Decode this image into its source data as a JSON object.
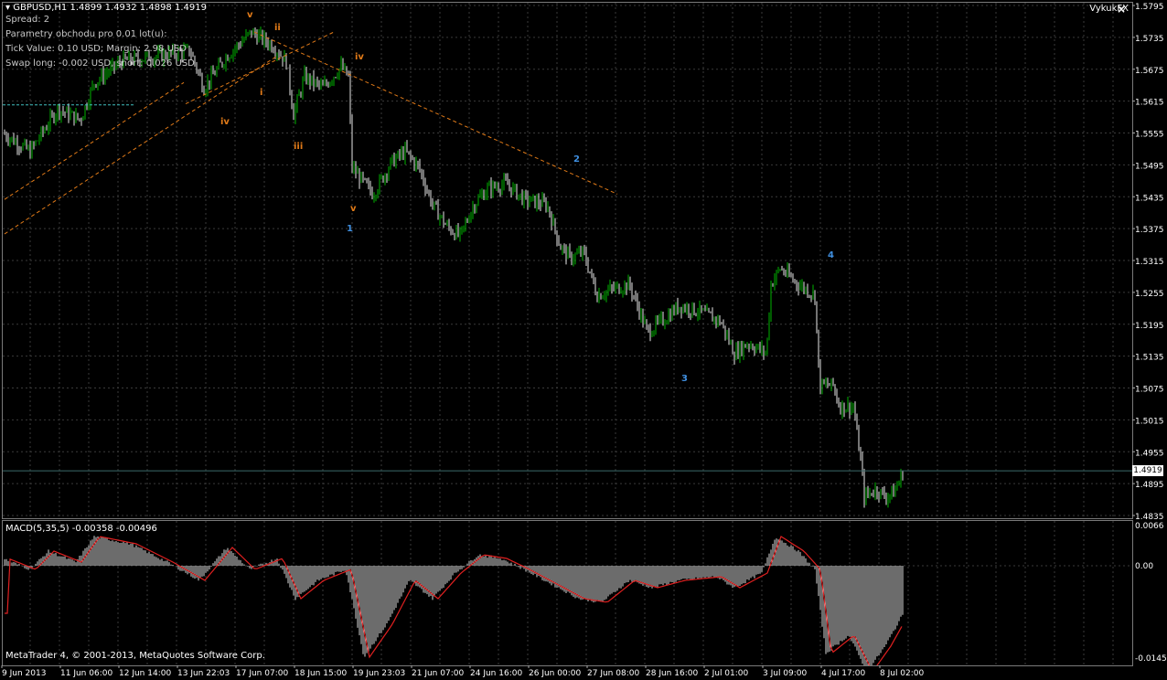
{
  "window": {
    "title": "GBPUSD,H1  1.4899 1.4932 1.4898 1.4919",
    "broker_badge": "VykukFX",
    "close_glyph": "×"
  },
  "info_lines": [
    "Spread: 2",
    "Parametry obchodu pro 0.01 lot(u):",
    "Tick Value: 0.10 USD; Margin: 2.98 USD",
    "Swap long: -0.002 USD, short: 0.026 USD"
  ],
  "price_axis": [
    "1.5795",
    "1.5735",
    "1.5675",
    "1.5615",
    "1.5555",
    "1.5495",
    "1.5435",
    "1.5375",
    "1.5315",
    "1.5255",
    "1.5195",
    "1.5135",
    "1.5075",
    "1.5015",
    "1.4955",
    "1.4895",
    "1.4835"
  ],
  "current_price": "1.4919",
  "macd": {
    "label": "MACD(5,35,5) -0.00358 -0.00496",
    "axis": [
      "0.0066",
      "0.00",
      "-0.01455"
    ]
  },
  "time_axis": [
    "9 Jun 2013",
    "11 Jun 06:00",
    "12 Jun 14:00",
    "13 Jun 22:03",
    "17 Jun 07:00",
    "18 Jun 15:00",
    "19 Jun 23:03",
    "21 Jun 07:00",
    "24 Jun 16:00",
    "26 Jun 00:00",
    "27 Jun 08:00",
    "28 Jun 16:00",
    "2 Jul 01:00",
    "3 Jul 09:00",
    "4 Jul 17:00",
    "8 Jul 02:00"
  ],
  "wave_labels_orange": [
    "v",
    "ii",
    "iv",
    "i",
    "iii",
    "iv",
    "v"
  ],
  "wave_labels_blue": [
    "1",
    "2",
    "3",
    "4"
  ],
  "footer": "MetaTrader 4, © 2001-2013, MetaQuotes Software Corp.",
  "colors": {
    "bull": "#00b400",
    "bear": "#e8e8e8",
    "grid": "#3a3a3a",
    "wave_orange": "#e07a18",
    "wave_blue": "#3f8fe0",
    "macd_signal": "#e02020"
  }
}
